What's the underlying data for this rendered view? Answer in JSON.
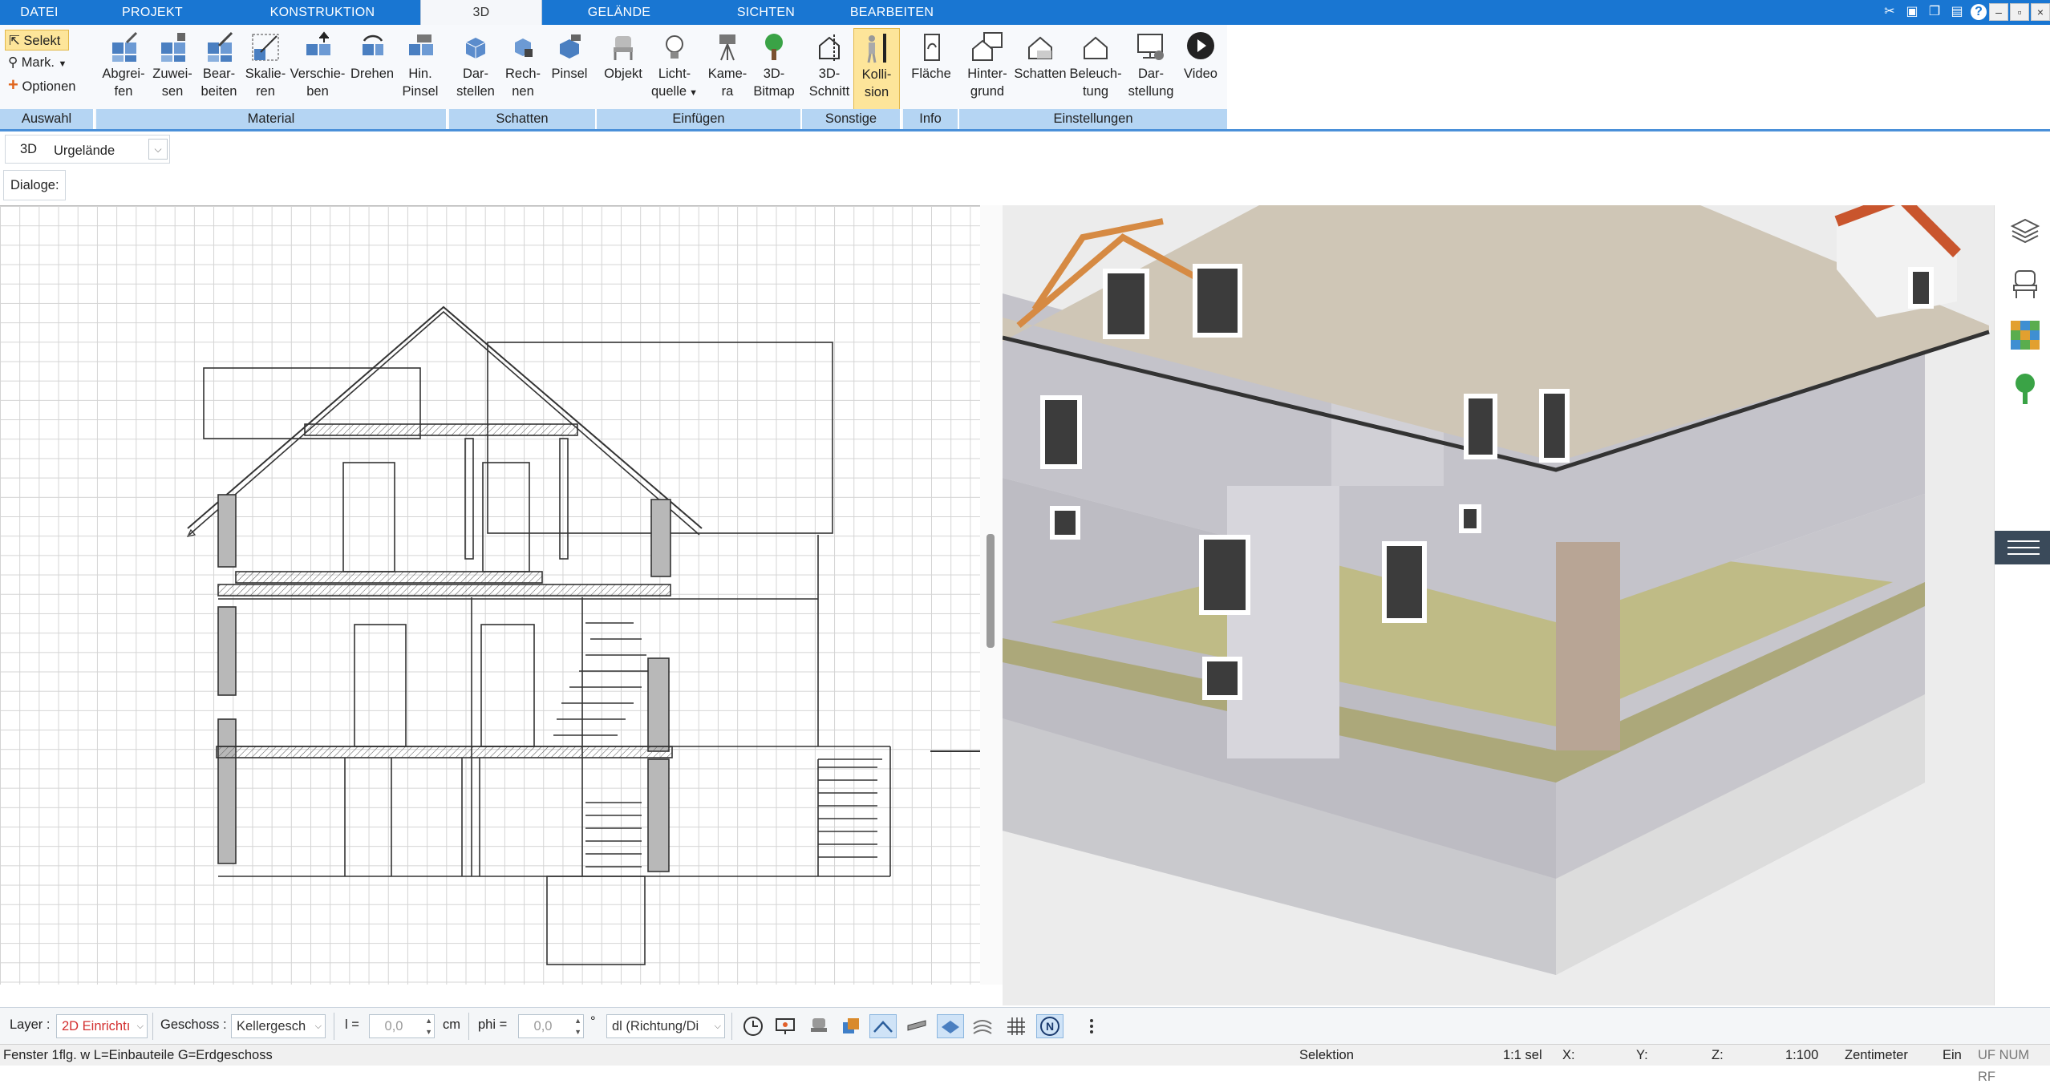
{
  "tabs": [
    {
      "label": "DATEI"
    },
    {
      "label": "PROJEKT"
    },
    {
      "label": "KONSTRUKTION"
    },
    {
      "label": "3D"
    },
    {
      "label": "GELÄNDE"
    },
    {
      "label": "SICHTEN"
    },
    {
      "label": "BEARBEITEN"
    }
  ],
  "active_tab": "3D",
  "auswahl": {
    "selekt": "Selekt",
    "mark": "Mark.",
    "optionen": "Optionen",
    "group": "Auswahl"
  },
  "ribbon": {
    "material": {
      "group": "Material",
      "buttons": [
        {
          "line1": "Abgrei-",
          "line2": "fen"
        },
        {
          "line1": "Zuwei-",
          "line2": "sen"
        },
        {
          "line1": "Bear-",
          "line2": "beiten"
        },
        {
          "line1": "Skalie-",
          "line2": "ren"
        },
        {
          "line1": "Verschie-",
          "line2": "ben"
        },
        {
          "line1": "Drehen",
          "line2": ""
        },
        {
          "line1": "Hin.",
          "line2": "Pinsel"
        }
      ]
    },
    "schatten": {
      "group": "Schatten",
      "buttons": [
        {
          "line1": "Dar-",
          "line2": "stellen"
        },
        {
          "line1": "Rech-",
          "line2": "nen"
        },
        {
          "line1": "Pinsel",
          "line2": ""
        }
      ]
    },
    "einfuegen": {
      "group": "Einfügen",
      "buttons": [
        {
          "line1": "Objekt",
          "line2": ""
        },
        {
          "line1": "Licht-",
          "line2": "quelle"
        },
        {
          "line1": "Kame-",
          "line2": "ra"
        },
        {
          "line1": "3D-",
          "line2": "Bitmap"
        }
      ]
    },
    "sonstige": {
      "group": "Sonstige",
      "buttons": [
        {
          "line1": "3D-",
          "line2": "Schnitt"
        },
        {
          "line1": "Kolli-",
          "line2": "sion"
        }
      ]
    },
    "info": {
      "group": "Info",
      "buttons": [
        {
          "line1": "Fläche",
          "line2": ""
        }
      ]
    },
    "einstellungen": {
      "group": "Einstellungen",
      "buttons": [
        {
          "line1": "Hinter-",
          "line2": "grund"
        },
        {
          "line1": "Schatten",
          "line2": ""
        },
        {
          "line1": "Beleuch-",
          "line2": "tung"
        },
        {
          "line1": "Dar-",
          "line2": "stellung"
        },
        {
          "line1": "Video",
          "line2": ""
        }
      ]
    }
  },
  "view_row": {
    "mode": "3D",
    "select_value": "Urgelände"
  },
  "dialoge_label": "Dialoge:",
  "toolbar": {
    "layer_label": "Layer :",
    "layer_value": "2D Einrichtı",
    "geschoss_label": "Geschoss :",
    "geschoss_value": "Kellergesch",
    "l_label": "l =",
    "l_value": "0,0",
    "l_unit": "cm",
    "phi_label": "phi =",
    "phi_value": "0,0",
    "phi_unit": "°",
    "dl_value": "dl (Richtung/Di"
  },
  "status": {
    "hint": "Fenster 1flg. w L=Einbauteile G=Erdgeschoss",
    "mode": "Selektion",
    "sel": "1:1 sel",
    "x": "X:",
    "y": "Y:",
    "z": "Z:",
    "scale": "1:100",
    "unit": "Zentimeter",
    "ein": "Ein",
    "flags": "UF NUM RF"
  },
  "colors": {
    "tabbar": "#1976d2",
    "group_bar": "#b5d5f3",
    "highlight": "#fde59a",
    "layer_value": "#d32f2f"
  }
}
